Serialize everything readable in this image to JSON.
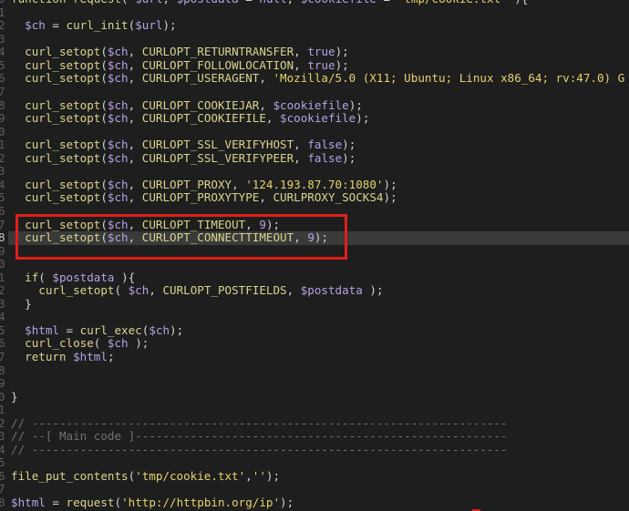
{
  "editor": {
    "theme": {
      "background": "#1e1e1e",
      "current_line": "#3a3a3a",
      "gutter": "#5e5e5e",
      "gutter_current": "#c4c4c4",
      "annotation": "#e01f1a",
      "tokens": {
        "f": "#d9d48e",
        "v": "#b5a2e4",
        "s": "#e4d36d",
        "l": "#b5a2e4",
        "p": "#d2d2d2",
        "c": "#717171"
      }
    },
    "cursor_line": 18,
    "line_numbers": [
      "0",
      "1",
      "2",
      "3",
      "4",
      "5",
      "6",
      "7",
      "8",
      "9",
      "0",
      "1",
      "2",
      "3",
      "4",
      "5",
      "6",
      "7",
      "8",
      "9",
      "0",
      "1",
      "2",
      "3",
      "4",
      "5",
      "6",
      "7",
      "8",
      "9",
      "0",
      "1",
      "2",
      "3",
      "4",
      "5",
      "6",
      "7",
      "8"
    ],
    "lines": [
      [
        {
          "f": "function"
        },
        {
          "p": " "
        },
        {
          "f": "request"
        },
        {
          "p": "( "
        },
        {
          "v": "$url"
        },
        {
          "p": ", "
        },
        {
          "v": "$postdata"
        },
        {
          "p": " = "
        },
        {
          "l": "null"
        },
        {
          "p": ", "
        },
        {
          "v": "$cookiefile"
        },
        {
          "p": " = "
        },
        {
          "s": "'tmp/cookie.txt'"
        },
        {
          "p": " ){"
        }
      ],
      [],
      [
        {
          "p": "  "
        },
        {
          "v": "$ch"
        },
        {
          "p": " = "
        },
        {
          "f": "curl_init"
        },
        {
          "p": "("
        },
        {
          "v": "$url"
        },
        {
          "p": ");"
        }
      ],
      [],
      [
        {
          "p": "  "
        },
        {
          "f": "curl_setopt"
        },
        {
          "p": "("
        },
        {
          "v": "$ch"
        },
        {
          "p": ", "
        },
        {
          "f": "CURLOPT_RETURNTRANSFER"
        },
        {
          "p": ", "
        },
        {
          "l": "true"
        },
        {
          "p": ");"
        }
      ],
      [
        {
          "p": "  "
        },
        {
          "f": "curl_setopt"
        },
        {
          "p": "("
        },
        {
          "v": "$ch"
        },
        {
          "p": ", "
        },
        {
          "f": "CURLOPT_FOLLOWLOCATION"
        },
        {
          "p": ", "
        },
        {
          "l": "true"
        },
        {
          "p": ");"
        }
      ],
      [
        {
          "p": "  "
        },
        {
          "f": "curl_setopt"
        },
        {
          "p": "("
        },
        {
          "v": "$ch"
        },
        {
          "p": ", "
        },
        {
          "f": "CURLOPT_USERAGENT"
        },
        {
          "p": ", "
        },
        {
          "s": "'Mozilla/5.0 (X11; Ubuntu; Linux x86_64; rv:47.0) G"
        }
      ],
      [],
      [
        {
          "p": "  "
        },
        {
          "f": "curl_setopt"
        },
        {
          "p": "("
        },
        {
          "v": "$ch"
        },
        {
          "p": ", "
        },
        {
          "f": "CURLOPT_COOKIEJAR"
        },
        {
          "p": ", "
        },
        {
          "v": "$cookiefile"
        },
        {
          "p": ");"
        }
      ],
      [
        {
          "p": "  "
        },
        {
          "f": "curl_setopt"
        },
        {
          "p": "("
        },
        {
          "v": "$ch"
        },
        {
          "p": ", "
        },
        {
          "f": "CURLOPT_COOKIEFILE"
        },
        {
          "p": ", "
        },
        {
          "v": "$cookiefile"
        },
        {
          "p": ");"
        }
      ],
      [],
      [
        {
          "p": "  "
        },
        {
          "f": "curl_setopt"
        },
        {
          "p": "("
        },
        {
          "v": "$ch"
        },
        {
          "p": ", "
        },
        {
          "f": "CURLOPT_SSL_VERIFYHOST"
        },
        {
          "p": ", "
        },
        {
          "l": "false"
        },
        {
          "p": ");"
        }
      ],
      [
        {
          "p": "  "
        },
        {
          "f": "curl_setopt"
        },
        {
          "p": "("
        },
        {
          "v": "$ch"
        },
        {
          "p": ", "
        },
        {
          "f": "CURLOPT_SSL_VERIFYPEER"
        },
        {
          "p": ", "
        },
        {
          "l": "false"
        },
        {
          "p": ");"
        }
      ],
      [],
      [
        {
          "p": "  "
        },
        {
          "f": "curl_setopt"
        },
        {
          "p": "("
        },
        {
          "v": "$ch"
        },
        {
          "p": ", "
        },
        {
          "f": "CURLOPT_PROXY"
        },
        {
          "p": ", "
        },
        {
          "s": "'124.193.87.70:1080'"
        },
        {
          "p": ");"
        }
      ],
      [
        {
          "p": "  "
        },
        {
          "f": "curl_setopt"
        },
        {
          "p": "("
        },
        {
          "v": "$ch"
        },
        {
          "p": ", "
        },
        {
          "f": "CURLOPT_PROXYTYPE"
        },
        {
          "p": ", "
        },
        {
          "f": "CURLPROXY_SOCKS4"
        },
        {
          "p": ");"
        }
      ],
      [],
      [
        {
          "p": "  "
        },
        {
          "f": "curl_setopt"
        },
        {
          "p": "("
        },
        {
          "v": "$ch"
        },
        {
          "p": ", "
        },
        {
          "f": "CURLOPT_TIMEOUT"
        },
        {
          "p": ", "
        },
        {
          "l": "9"
        },
        {
          "p": ");"
        }
      ],
      [
        {
          "p": "  "
        },
        {
          "f": "curl_setopt"
        },
        {
          "p": "("
        },
        {
          "v": "$ch"
        },
        {
          "p": ", "
        },
        {
          "f": "CURLOPT_CONNECTTIMEOUT"
        },
        {
          "p": ", "
        },
        {
          "l": "9"
        },
        {
          "p": ");"
        }
      ],
      [],
      [],
      [
        {
          "p": "  "
        },
        {
          "f": "if"
        },
        {
          "p": "( "
        },
        {
          "v": "$postdata"
        },
        {
          "p": " ){"
        }
      ],
      [
        {
          "p": "    "
        },
        {
          "f": "curl_setopt"
        },
        {
          "p": "( "
        },
        {
          "v": "$ch"
        },
        {
          "p": ", "
        },
        {
          "f": "CURLOPT_POSTFIELDS"
        },
        {
          "p": ", "
        },
        {
          "v": "$postdata"
        },
        {
          "p": " );"
        }
      ],
      [
        {
          "p": "  }"
        }
      ],
      [],
      [
        {
          "p": "  "
        },
        {
          "v": "$html"
        },
        {
          "p": " = "
        },
        {
          "f": "curl_exec"
        },
        {
          "p": "("
        },
        {
          "v": "$ch"
        },
        {
          "p": ");"
        }
      ],
      [
        {
          "p": "  "
        },
        {
          "f": "curl_close"
        },
        {
          "p": "( "
        },
        {
          "v": "$ch"
        },
        {
          "p": " );"
        }
      ],
      [
        {
          "p": "  "
        },
        {
          "f": "return"
        },
        {
          "p": " "
        },
        {
          "v": "$html"
        },
        {
          "p": ";"
        }
      ],
      [],
      [],
      [
        {
          "p": "}"
        }
      ],
      [],
      [
        {
          "c": "// ---------------------------------------------------------------------"
        }
      ],
      [
        {
          "c": "// --[ Main code ]------------------------------------------------------"
        }
      ],
      [
        {
          "c": "// ---------------------------------------------------------------------"
        }
      ],
      [],
      [
        {
          "f": "file_put_contents"
        },
        {
          "p": "("
        },
        {
          "s": "'tmp/cookie.txt'"
        },
        {
          "p": ","
        },
        {
          "s": "''"
        },
        {
          "p": ");"
        }
      ],
      [],
      [
        {
          "v": "$html"
        },
        {
          "p": " = "
        },
        {
          "f": "request"
        },
        {
          "p": "("
        },
        {
          "s": "'http://httpbin.org/ip'"
        },
        {
          "p": ");"
        }
      ]
    ]
  }
}
